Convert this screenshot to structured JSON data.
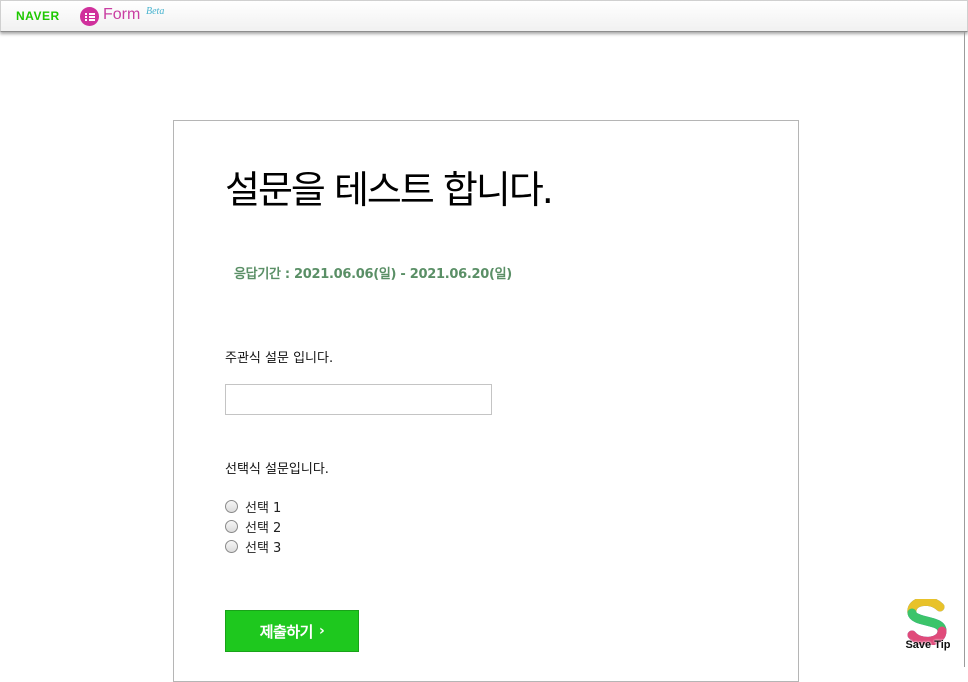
{
  "header": {
    "brand": "NAVER",
    "product": "Form",
    "badge": "Beta"
  },
  "survey": {
    "title": "설문을 테스트 합니다.",
    "period": "응답기간 : 2021.06.06(일) - 2021.06.20(일)",
    "q1": {
      "label": "주관식 설문 입니다.",
      "value": "",
      "placeholder": ""
    },
    "q2": {
      "label": "선택식 설문입니다.",
      "options": [
        "선택 1",
        "선택 2",
        "선택 3"
      ]
    },
    "submit_label": "제출하기",
    "submit_icon": "chevron-right-icon"
  },
  "watermark": {
    "text": "Save Tip"
  },
  "colors": {
    "naver_green": "#1ec800",
    "form_pink": "#d0309c",
    "period_green": "#5a8f66",
    "submit_green": "#1ec81e"
  }
}
